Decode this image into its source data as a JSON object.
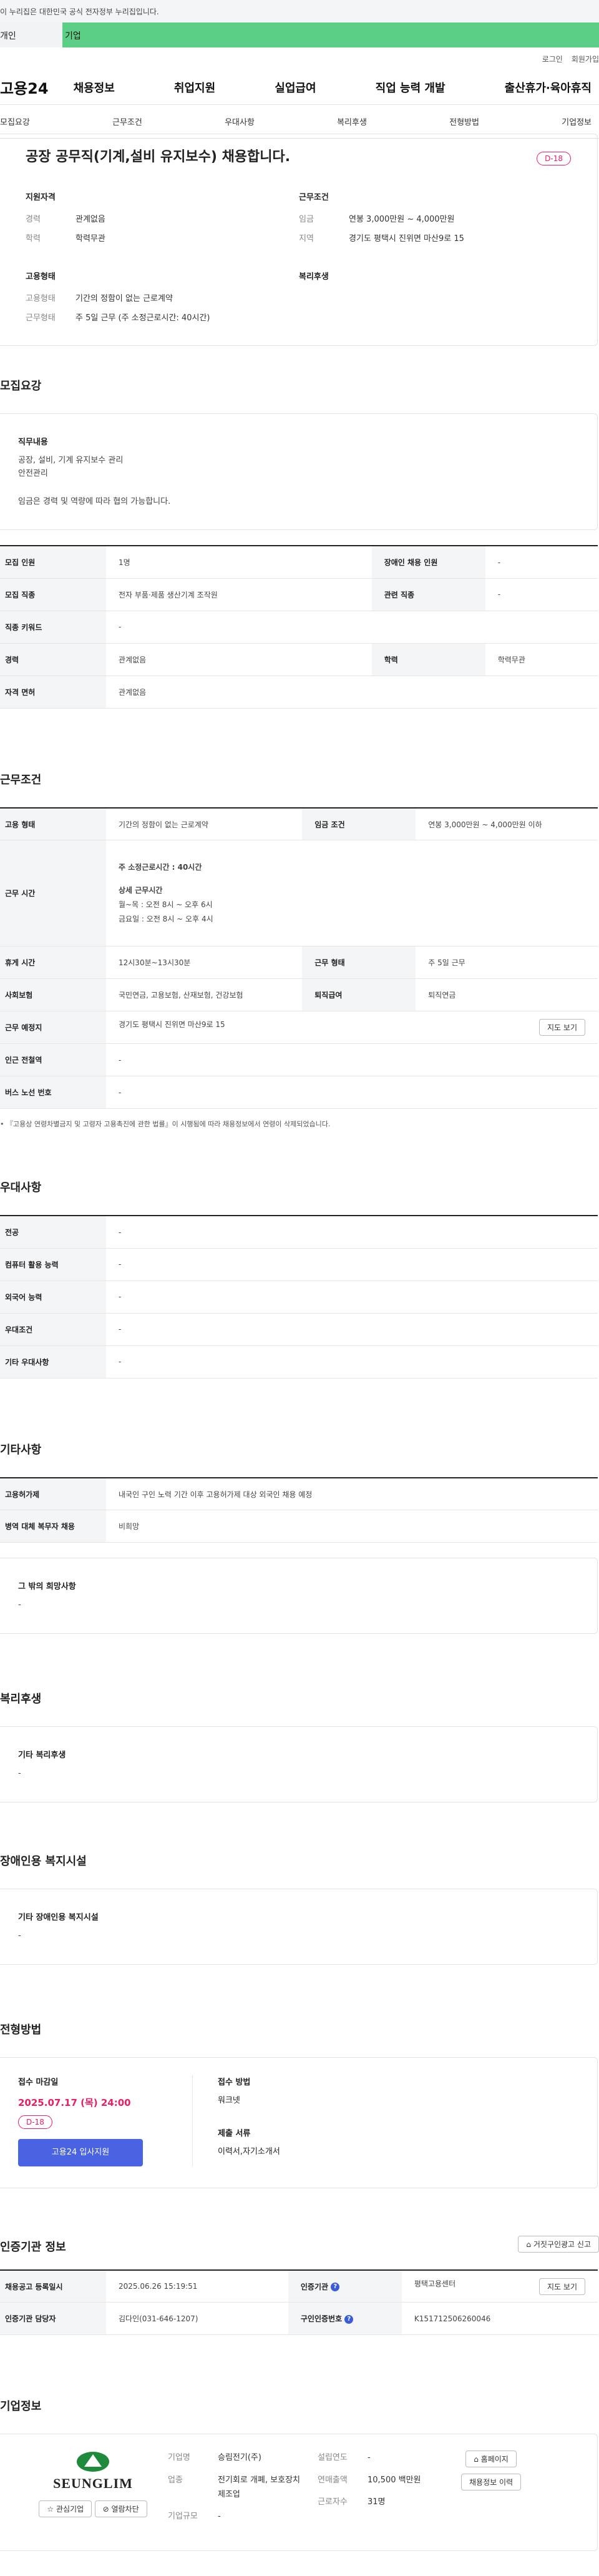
{
  "banner": {
    "text": "이 누리집은 대한민국 공식 전자정부 누리집입니다."
  },
  "user_tabs": [
    "개인",
    "기업"
  ],
  "util": [
    "로그인",
    "회원가입"
  ],
  "logo": "고용24",
  "gnb": [
    "채용정보",
    "취업지원",
    "실업급여",
    "직업 능력 개발",
    "출산휴가·육아휴직"
  ],
  "subnav": [
    "모집요강",
    "근무조건",
    "우대사항",
    "복리후생",
    "전형방법",
    "기업정보"
  ],
  "header": {
    "title": "공장 공무직(기계,설비 유지보수) 채용합니다.",
    "dday": "D-18",
    "qual": {
      "title": "지원자격",
      "rows": [
        [
          "경력",
          "관계없음"
        ],
        [
          "학력",
          "학력무관"
        ]
      ]
    },
    "cond": {
      "title": "근무조건",
      "rows": [
        [
          "임금",
          "연봉 3,000만원 ~ 4,000만원"
        ],
        [
          "지역",
          "경기도 평택시 진위면 마산9로 15"
        ]
      ]
    },
    "emp": {
      "title": "고용형태",
      "rows": [
        [
          "고용형태",
          "기간의 정함이 없는 근로계약"
        ],
        [
          "근무형태",
          "주 5일 근무 (주 소정근로시간: 40시간)"
        ]
      ]
    },
    "welfare": {
      "title": "복리후생"
    }
  },
  "recruit": {
    "title": "모집요강",
    "job_h": "직무내용",
    "job_lines": [
      "공장, 설비, 기계 유지보수 관리",
      "안전관리"
    ],
    "job_note": "임금은 경력 및 역량에 따라 협의 가능합니다.",
    "rows": [
      [
        "모집 인원",
        "1명",
        "장애인 채용 인원",
        "-"
      ],
      [
        "모집 직종",
        "전자 부품·제품 생산기계 조작원",
        "관련 직종",
        "-"
      ],
      [
        "직종 키워드",
        "-"
      ],
      [
        "경력",
        "관계없음",
        "학력",
        "학력무관"
      ],
      [
        "자격 면허",
        "관계없음"
      ]
    ]
  },
  "work": {
    "title": "근무조건",
    "r1": [
      "고용 형태",
      "기간의 정함이 없는 근로계약",
      "임금 조건",
      "연봉 3,000만원 ~ 4,000만원 이하"
    ],
    "hours_th": "근무 시간",
    "hours_main": "주 소정근로시간 : 40시간",
    "hours_sub": "상세 근무시간",
    "hours_lines": [
      "월~목 : 오전 8시 ~ 오후 6시",
      "금요일 : 오전 8시 ~ 오후 4시"
    ],
    "rows": [
      [
        "휴게 시간",
        "12시30분~13시30분",
        "근무 형태",
        "주 5일 근무"
      ],
      [
        "사회보험",
        "국민연금, 고용보험, 산재보험, 건강보험",
        "퇴직급여",
        "퇴직연금"
      ]
    ],
    "loc": [
      "근무 예정지",
      "경기도 평택시 진위면 마산9로 15",
      "지도 보기"
    ],
    "rows2": [
      [
        "인근 전철역",
        "-"
      ],
      [
        "버스 노선 번호",
        "-"
      ]
    ],
    "note": "• 『고용상 연령차별금지 및 고령자 고용촉진에 관한 법률』이 시행됨에 따라 채용정보에서 연령이 삭제되었습니다."
  },
  "pref": {
    "title": "우대사항",
    "rows": [
      [
        "전공",
        "-"
      ],
      [
        "컴퓨터 활용 능력",
        "-"
      ],
      [
        "외국어 능력",
        "-"
      ],
      [
        "우대조건",
        "-"
      ],
      [
        "기타 우대사항",
        "-"
      ]
    ]
  },
  "etc": {
    "title": "기타사항",
    "rows": [
      [
        "고용허가제",
        "내국인 구인 노력 기간 이후 고용허가제 대상 외국인 채용 예정"
      ],
      [
        "병역 대체 복무자 채용",
        "비희망"
      ]
    ],
    "box_h": "그 밖의 희망사항",
    "box_v": "-"
  },
  "welfare": {
    "title": "복리후생",
    "h": "기타 복리후생",
    "v": "-"
  },
  "disab": {
    "title": "장애인용 복지시설",
    "h": "기타 장애인용 복지시설",
    "v": "-"
  },
  "process": {
    "title": "전형방법",
    "deadline_h": "접수 마감일",
    "deadline": "2025.07.17 (목) 24:00",
    "dday": "D-18",
    "apply_btn": "고용24 입사지원",
    "method_h": "접수 방법",
    "method": "워크넷",
    "docs_h": "제출 서류",
    "docs": "이력서,자기소개서"
  },
  "cert": {
    "title": "인증기관 정보",
    "report_btn": "거짓구인광고 신고",
    "r1": [
      "채용공고 등록일시",
      "2025.06.26 15:19:51",
      "인증기관",
      "평택고용센터",
      "지도 보기"
    ],
    "r2": [
      "인증기관 담당자",
      "김다인(031-646-1207)",
      "구인인증번호",
      "K151712506260046"
    ]
  },
  "company": {
    "title": "기업정보",
    "logo_text": "SEUNGLIM",
    "fav": "관심기업",
    "block": "열람차단",
    "rows": [
      [
        "기업명",
        "승림전기(주)"
      ],
      [
        "업종",
        "전기회로 개폐, 보호장치 제조업"
      ],
      [
        "기업규모",
        "-"
      ]
    ],
    "rows2": [
      [
        "설립연도",
        "-"
      ],
      [
        "연매출액",
        "10,500 백만원"
      ],
      [
        "근로자수",
        "31명"
      ]
    ],
    "home_btn": "홈페이지",
    "hist_btn": "채용정보 이력"
  }
}
